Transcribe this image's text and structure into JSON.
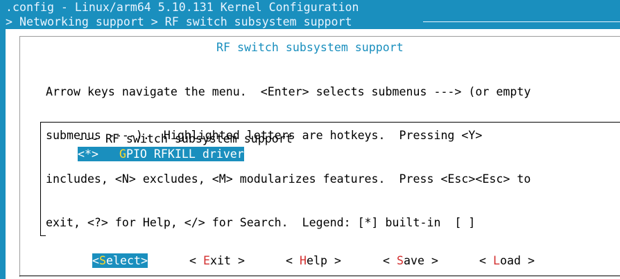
{
  "window": {
    "title": ".config - Linux/arm64 5.10.131 Kernel Configuration",
    "breadcrumb": "> Networking support > RF switch subsystem support"
  },
  "dialog": {
    "title": "RF switch subsystem support",
    "help_lines": [
      "Arrow keys navigate the menu.  <Enter> selects submenus ---> (or empty",
      "submenus ----).  Highlighted letters are hotkeys.  Pressing <Y>",
      "includes, <N> excludes, <M> modularizes features.  Press <Esc><Esc> to",
      "exit, <?> for Help, </> for Search.  Legend: [*] built-in  [ ]"
    ]
  },
  "menu": {
    "items": [
      {
        "text": "--- RF switch subsystem support"
      },
      {
        "prefix": "<*>   ",
        "hotkey": "G",
        "rest": "PIO RFKILL driver",
        "selected": true
      }
    ]
  },
  "buttons": [
    {
      "before": "<",
      "hotkey": "S",
      "after": "elect>",
      "selected": true
    },
    {
      "before": "< ",
      "hotkey": "E",
      "after": "xit >",
      "selected": false
    },
    {
      "before": "< ",
      "hotkey": "H",
      "after": "elp >",
      "selected": false
    },
    {
      "before": "< ",
      "hotkey": "S",
      "after": "ave >",
      "selected": false
    },
    {
      "before": "< ",
      "hotkey": "L",
      "after": "oad >",
      "selected": false
    }
  ],
  "colors": {
    "accent": "#1a8fbe",
    "hotkey_highlight": "#ffd92a",
    "hotkey": "#d32f2f"
  }
}
